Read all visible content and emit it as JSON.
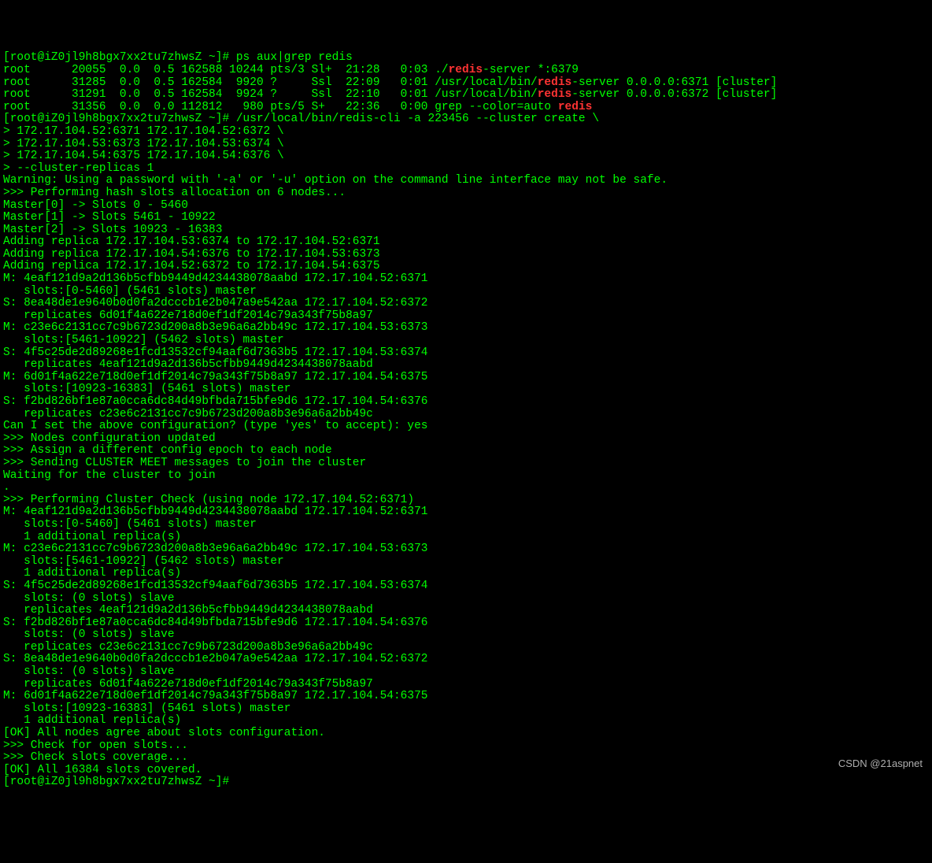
{
  "prompt": "[root@iZ0jl9h8bgx7xx2tu7zhwsZ ~]# ",
  "cmd_ps": "ps aux|grep redis",
  "ps": {
    "hl": "redis",
    "rows": [
      {
        "user": "root",
        "pid": "20055",
        "cpu": "0.0",
        "mem": "0.5",
        "vsz": "162588",
        "rss": "10244",
        "tty": "pts/3",
        "stat": "Sl+",
        "start": "21:28",
        "time": "0:03",
        "cmd_pre": "./",
        "cmd_hl": "redis",
        "cmd_post": "-server *:6379"
      },
      {
        "user": "root",
        "pid": "31285",
        "cpu": "0.0",
        "mem": "0.5",
        "vsz": "162584",
        "rss": "9920",
        "tty": "?",
        "stat": "Ssl",
        "start": "22:09",
        "time": "0:01",
        "cmd_pre": "/usr/local/bin/",
        "cmd_hl": "redis",
        "cmd_post": "-server 0.0.0.0:6371 [cluster]"
      },
      {
        "user": "root",
        "pid": "31291",
        "cpu": "0.0",
        "mem": "0.5",
        "vsz": "162584",
        "rss": "9924",
        "tty": "?",
        "stat": "Ssl",
        "start": "22:10",
        "time": "0:01",
        "cmd_pre": "/usr/local/bin/",
        "cmd_hl": "redis",
        "cmd_post": "-server 0.0.0.0:6372 [cluster]"
      },
      {
        "user": "root",
        "pid": "31356",
        "cpu": "0.0",
        "mem": "0.0",
        "vsz": "112812",
        "rss": "980",
        "tty": "pts/5",
        "stat": "S+",
        "start": "22:36",
        "time": "0:00",
        "cmd_pre": "grep --color=auto ",
        "cmd_hl": "redis",
        "cmd_post": ""
      }
    ]
  },
  "cmd_cluster": "/usr/local/bin/redis-cli -a 223456 --cluster create \\",
  "cont": [
    "> 172.17.104.52:6371 172.17.104.52:6372 \\",
    "> 172.17.104.53:6373 172.17.104.53:6374 \\",
    "> 172.17.104.54:6375 172.17.104.54:6376 \\",
    "> --cluster-replicas 1"
  ],
  "warn": "Warning: Using a password with '-a' or '-u' option on the command line interface may not be safe.",
  "lines_a": [
    ">>> Performing hash slots allocation on 6 nodes...",
    "Master[0] -> Slots 0 - 5460",
    "Master[1] -> Slots 5461 - 10922",
    "Master[2] -> Slots 10923 - 16383",
    "Adding replica 172.17.104.53:6374 to 172.17.104.52:6371",
    "Adding replica 172.17.104.54:6376 to 172.17.104.53:6373",
    "Adding replica 172.17.104.52:6372 to 172.17.104.54:6375",
    "M: 4eaf121d9a2d136b5cfbb9449d4234438078aabd 172.17.104.52:6371",
    "   slots:[0-5460] (5461 slots) master",
    "S: 8ea48de1e9640b0d0fa2dcccb1e2b047a9e542aa 172.17.104.52:6372",
    "   replicates 6d01f4a622e718d0ef1df2014c79a343f75b8a97",
    "M: c23e6c2131cc7c9b6723d200a8b3e96a6a2bb49c 172.17.104.53:6373",
    "   slots:[5461-10922] (5462 slots) master",
    "S: 4f5c25de2d89268e1fcd13532cf94aaf6d7363b5 172.17.104.53:6374",
    "   replicates 4eaf121d9a2d136b5cfbb9449d4234438078aabd",
    "M: 6d01f4a622e718d0ef1df2014c79a343f75b8a97 172.17.104.54:6375",
    "   slots:[10923-16383] (5461 slots) master",
    "S: f2bd826bf1e87a0cca6dc84d49bfbda715bfe9d6 172.17.104.54:6376",
    "   replicates c23e6c2131cc7c9b6723d200a8b3e96a6a2bb49c",
    "Can I set the above configuration? (type 'yes' to accept): yes",
    ">>> Nodes configuration updated",
    ">>> Assign a different config epoch to each node",
    ">>> Sending CLUSTER MEET messages to join the cluster",
    "Waiting for the cluster to join",
    ".",
    ">>> Performing Cluster Check (using node 172.17.104.52:6371)",
    "M: 4eaf121d9a2d136b5cfbb9449d4234438078aabd 172.17.104.52:6371",
    "   slots:[0-5460] (5461 slots) master",
    "   1 additional replica(s)",
    "M: c23e6c2131cc7c9b6723d200a8b3e96a6a2bb49c 172.17.104.53:6373",
    "   slots:[5461-10922] (5462 slots) master",
    "   1 additional replica(s)",
    "S: 4f5c25de2d89268e1fcd13532cf94aaf6d7363b5 172.17.104.53:6374",
    "   slots: (0 slots) slave",
    "   replicates 4eaf121d9a2d136b5cfbb9449d4234438078aabd",
    "S: f2bd826bf1e87a0cca6dc84d49bfbda715bfe9d6 172.17.104.54:6376",
    "   slots: (0 slots) slave",
    "   replicates c23e6c2131cc7c9b6723d200a8b3e96a6a2bb49c",
    "S: 8ea48de1e9640b0d0fa2dcccb1e2b047a9e542aa 172.17.104.52:6372",
    "   slots: (0 slots) slave",
    "   replicates 6d01f4a622e718d0ef1df2014c79a343f75b8a97",
    "M: 6d01f4a622e718d0ef1df2014c79a343f75b8a97 172.17.104.54:6375",
    "   slots:[10923-16383] (5461 slots) master",
    "   1 additional replica(s)",
    "[OK] All nodes agree about slots configuration.",
    ">>> Check for open slots...",
    ">>> Check slots coverage...",
    "[OK] All 16384 slots covered."
  ],
  "watermark": "CSDN @21aspnet"
}
